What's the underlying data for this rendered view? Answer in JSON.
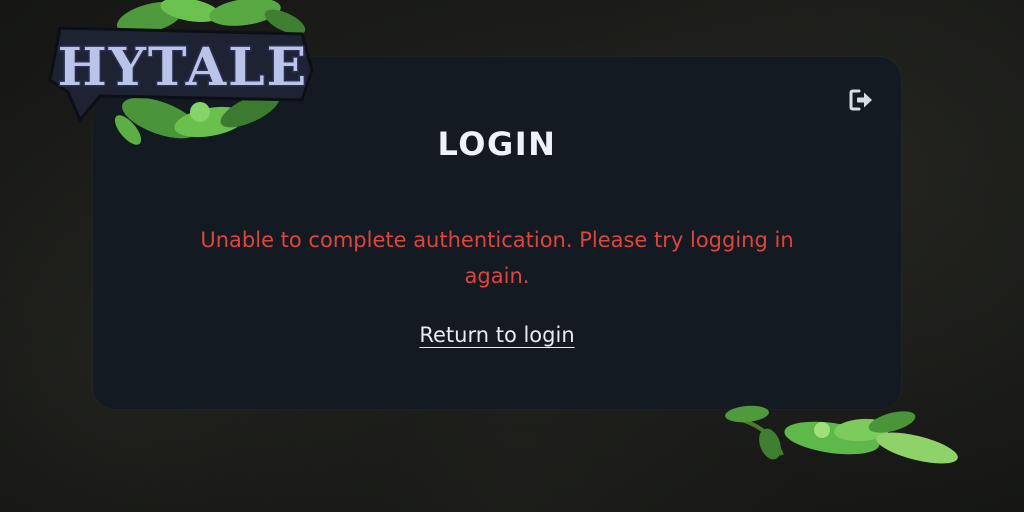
{
  "brand": {
    "logo_text": "HYTALE"
  },
  "login_card": {
    "title": "LOGIN",
    "error_message": "Unable to complete authentication. Please try logging in again.",
    "return_link": "Return to login",
    "logout_icon": "sign-out-icon"
  },
  "colors": {
    "background": "#1b1c19",
    "card": "#131a22",
    "title": "#eef3f9",
    "error": "#e0443e",
    "link": "#e8ecf1",
    "leaf": "#5fb84a"
  }
}
